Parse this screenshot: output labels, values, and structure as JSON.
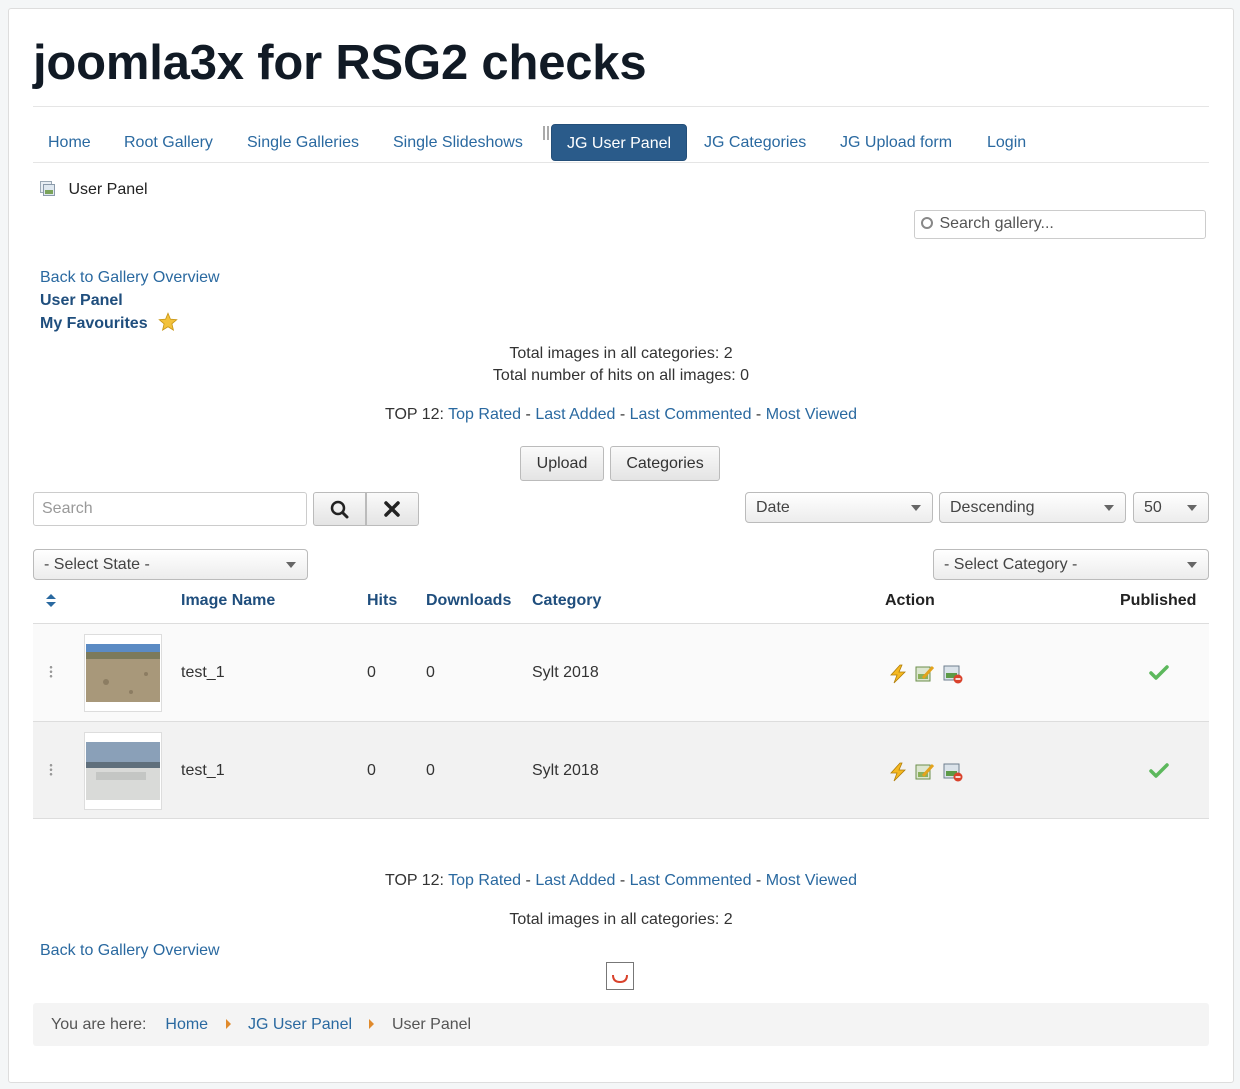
{
  "site": {
    "title": "joomla3x for RSG2 checks"
  },
  "nav": {
    "items": [
      {
        "label": "Home"
      },
      {
        "label": "Root Gallery"
      },
      {
        "label": "Single Galleries"
      },
      {
        "label": "Single Slideshows"
      },
      {
        "label": "JG User Panel",
        "active": true
      },
      {
        "label": "JG Categories"
      },
      {
        "label": "JG Upload form"
      },
      {
        "label": "Login"
      }
    ]
  },
  "page_heading": "User Panel",
  "gallery_search": {
    "placeholder": "Search gallery..."
  },
  "side_links": {
    "back": "Back to Gallery Overview",
    "user_panel": "User Panel",
    "favourites": "My Favourites"
  },
  "stats": {
    "total_images": "Total images in all categories: 2",
    "total_hits": "Total number of hits on all images: 0"
  },
  "top12": {
    "prefix": "TOP 12:",
    "sep": "-",
    "top_rated": "Top Rated",
    "last_added": "Last Added",
    "last_commented": "Last Commented",
    "most_viewed": "Most Viewed"
  },
  "buttons": {
    "upload": "Upload",
    "categories": "Categories"
  },
  "filter": {
    "search_placeholder": "Search",
    "order_by": "Date",
    "direction": "Descending",
    "limit": "50",
    "state": "- Select State -",
    "category": "- Select Category -"
  },
  "table": {
    "headers": {
      "image_name": "Image Name",
      "hits": "Hits",
      "downloads": "Downloads",
      "category": "Category",
      "action": "Action",
      "published": "Published"
    },
    "rows": [
      {
        "name": "test_1",
        "hits": "0",
        "downloads": "0",
        "category": "Sylt 2018"
      },
      {
        "name": "test_1",
        "hits": "0",
        "downloads": "0",
        "category": "Sylt 2018"
      }
    ]
  },
  "breadcrumbs": {
    "label": "You are here:",
    "items": [
      "Home",
      "JG User Panel",
      "User Panel"
    ]
  },
  "colors": {
    "accent": "#2a69a0",
    "nav_active": "#2a5b8a",
    "breadcrumb_sep": "#e08a2c",
    "published_check": "#5cb85c"
  }
}
